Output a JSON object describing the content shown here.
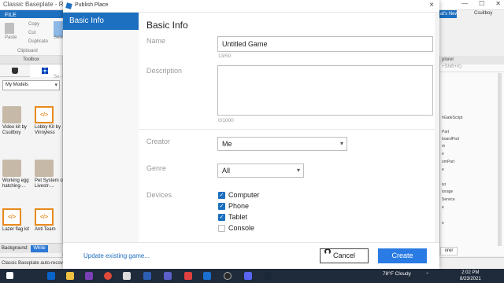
{
  "studio": {
    "window_title": "Classic Baseplate - Roblo",
    "window_controls": [
      "—",
      "☐",
      "✕"
    ],
    "file_menu": "FILE",
    "ribbon": {
      "paste": "Paste",
      "copy": "Copy",
      "cut": "Cut",
      "duplicate": "Duplicate",
      "clipboard": "Clipboard",
      "select": "Selec"
    },
    "whats_new": "at's New",
    "user": "Csuitboy",
    "toolbox": {
      "title": "Toolbox",
      "category": "My Models",
      "search_placeholder": "Se",
      "items": [
        {
          "label": "Video kit by Csuitboy",
          "kind": "model"
        },
        {
          "label": "Lobby Kit by Vinnyless",
          "kind": "code"
        },
        {
          "label": "Working egg hatching-...",
          "kind": "model"
        },
        {
          "label": "Pet System on Livestr-...",
          "kind": "model"
        },
        {
          "label": "Lazer flag kit",
          "kind": "code"
        },
        {
          "label": "Anti Team",
          "kind": "code"
        }
      ],
      "background_label": "Background:",
      "background_value": "White"
    },
    "explorer": {
      "title": "plorer",
      "filter": "+Shift+X)",
      "items": [
        "hGateScript",
        "Part",
        "boardPart",
        "m",
        "e",
        "omPart",
        "e",
        "ist",
        "torage",
        "Service",
        "e",
        "e"
      ],
      "tab": "orer"
    },
    "status": "Classic Baseplate auto-recover"
  },
  "dialog": {
    "title": "Publish Place",
    "close": "×",
    "sidebar": [
      {
        "label": "Basic Info",
        "active": true
      }
    ],
    "heading": "Basic Info",
    "name": {
      "label": "Name",
      "value": "Untitled Game",
      "counter": "13/50"
    },
    "description": {
      "label": "Description",
      "value": "",
      "counter": "0/1000"
    },
    "creator": {
      "label": "Creator",
      "value": "Me"
    },
    "genre": {
      "label": "Genre",
      "value": "All"
    },
    "devices": {
      "label": "Devices",
      "options": [
        {
          "label": "Computer",
          "checked": true
        },
        {
          "label": "Phone",
          "checked": true
        },
        {
          "label": "Tablet",
          "checked": true
        },
        {
          "label": "Console",
          "checked": false
        }
      ]
    },
    "footer": {
      "update_link": "Update existing game...",
      "cancel": "Cancel",
      "create": "Create"
    },
    "colors": {
      "accent": "#1d6fbf",
      "create_button": "#2a7be4"
    }
  },
  "taskbar": {
    "weather": "78°F  Cloudy",
    "time": "2:02 PM",
    "date": "8/23/2021",
    "icons": [
      "windows-start-icon",
      "outlook-icon",
      "file-explorer-icon",
      "onenote-icon",
      "chrome-icon",
      "word-icon",
      "teams-icon",
      "roblox-icon",
      "roblox-studio-icon",
      "discord-icon",
      "obs-icon",
      "music-icon",
      "steam-icon"
    ]
  }
}
